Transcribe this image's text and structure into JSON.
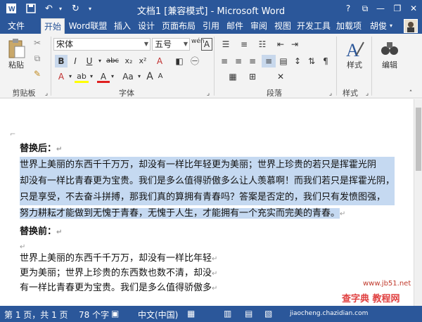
{
  "titlebar": {
    "title": "文档1 [兼容模式] - Microsoft Word",
    "help": "?",
    "minimize": "—",
    "restore": "❐",
    "close": "✕"
  },
  "tabs": [
    "文件",
    "开始",
    "Word联盟",
    "插入",
    "设计",
    "页面布局",
    "引用",
    "邮件",
    "审阅",
    "视图",
    "开发工具",
    "加载项"
  ],
  "user": "胡俊",
  "ribbon": {
    "paste": "粘贴",
    "font_name": "宋体",
    "font_size": "五号",
    "wen": "wén",
    "A_box": "A",
    "bold": "B",
    "italic": "I",
    "underline": "U",
    "strike": "abc",
    "sub": "x₂",
    "sup": "x²",
    "clear": "A",
    "font_color": "A",
    "highlight": "ab",
    "case": "Aa",
    "bigA": "A",
    "smallA": "A",
    "style_label": "样式",
    "edit_label": "编辑",
    "groups": {
      "clipboard": "剪贴板",
      "font": "字体",
      "paragraph": "段落",
      "styles": "样式"
    }
  },
  "doc": {
    "heading_after": "替换后：",
    "after_lines": [
      "世界上美丽的东西千千万万，却没有一样比年轻更为美丽；世界上珍贵的若只是挥霍光阴",
      "却没有一样比青春更为宝贵。我们是多么值得骄傲多么让人羡慕啊！而我们若只是挥霍光阴，",
      "只是享受，不去奋斗拼搏，那我们真的算拥有青春吗？答案是否定的，我们只有发愤图强，",
      "努力耕耘才能做到无愧于青春，无愧于人生，才能拥有一个充实而完美的青春。"
    ],
    "heading_before": "替换前：",
    "before_lines": [
      "世界上美丽的东西千千万万，却没有一样比年轻",
      "更为美丽；世界上珍贵的东西数也数不清，却没",
      "有一样比青春更为宝贵。我们是多么值得骄傲多"
    ],
    "return_mark": "↵"
  },
  "status": {
    "page": "第 1 页，共 1 页",
    "words": "78 个字",
    "lang": "中文(中国)"
  },
  "watermark": {
    "site": "www.jb51.net",
    "brand": "查字典 教程网",
    "url": "jiaocheng.chazidian.com"
  }
}
